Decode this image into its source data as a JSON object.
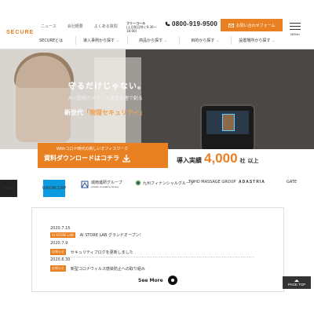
{
  "header": {
    "logo": "SECURE",
    "top_links": [
      "ニュース",
      "会社概要",
      "よくある質問"
    ],
    "freecall_label": "フリーコール",
    "freecall_hours": "(土日祝日除く9:30〜18:00)",
    "phone": "0800-919-9500",
    "contact_button": "お問い合わせフォーム",
    "menu_label": "MENU"
  },
  "nav": {
    "items": [
      "SECUREとは",
      "導入事例から探す",
      "商品から探す",
      "目的から探す",
      "設置場所から探す"
    ]
  },
  "hero": {
    "main": "守るだけじゃない。",
    "sub": "AI×監視カメラ・入退室管理で創る",
    "line_prefix": "新世代",
    "line_quote": "「物理セキュリティ」"
  },
  "download_banner": {
    "line1": "Withコロナ時代の新しいオフィスワーク",
    "line2": "資料ダウンロードはコチラ"
  },
  "stats": {
    "prefix": "導入実績",
    "number": "4,000",
    "unit": "社",
    "suffix": "以上"
  },
  "clients": {
    "c1": "Group",
    "c2": "UNIONCORP",
    "c3": "城南進研グループ",
    "c3_sub": "Johnan Academy Group",
    "c4": "九州フィナンシャルグループ",
    "c5": "TOHO MASSAGE GROUP",
    "c6": "ADASTRIA",
    "c7": "GATE"
  },
  "news": {
    "items": [
      {
        "date": "2020.7.15",
        "tag": "AI STORE LAB",
        "title": "AI STORE LAB グランドオープン！"
      },
      {
        "date": "2020.7.9",
        "tag": "お知らせ",
        "title": "セキュリティブログを更新しました"
      },
      {
        "date": "2020.6.30",
        "tag": "お知らせ",
        "title": "新型コロナウィルス感染防止への取り組み"
      }
    ],
    "see_more": "See More"
  },
  "page_top": "PAGE TOP",
  "colors": {
    "accent": "#e98022"
  }
}
